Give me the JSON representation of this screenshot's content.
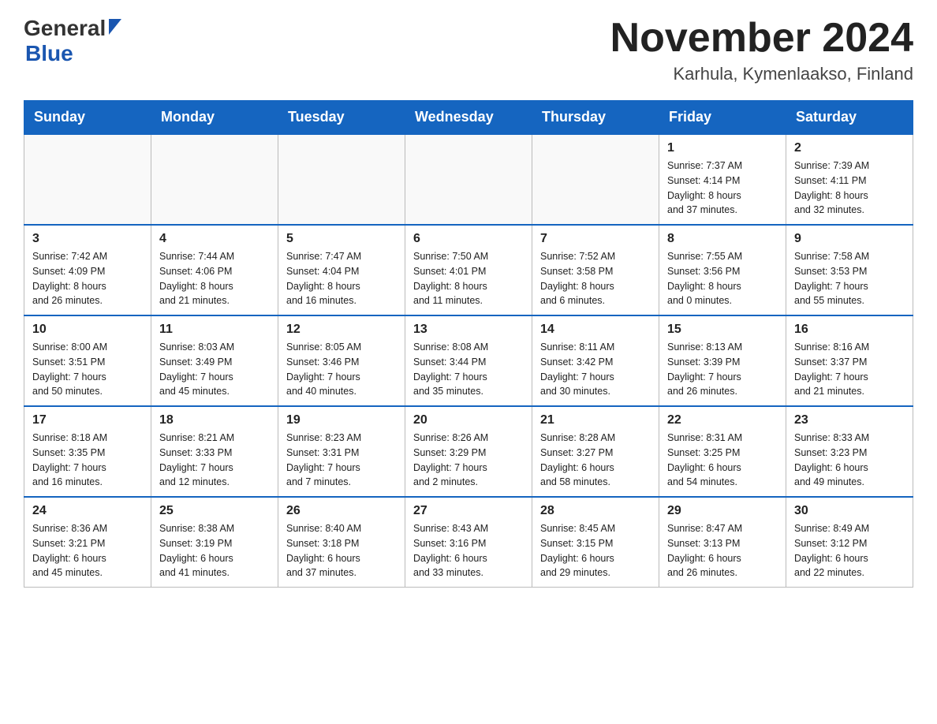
{
  "header": {
    "logo_general": "General",
    "logo_blue": "Blue",
    "month_title": "November 2024",
    "location": "Karhula, Kymenlaakso, Finland"
  },
  "days_of_week": [
    "Sunday",
    "Monday",
    "Tuesday",
    "Wednesday",
    "Thursday",
    "Friday",
    "Saturday"
  ],
  "weeks": [
    [
      {
        "day": "",
        "info": ""
      },
      {
        "day": "",
        "info": ""
      },
      {
        "day": "",
        "info": ""
      },
      {
        "day": "",
        "info": ""
      },
      {
        "day": "",
        "info": ""
      },
      {
        "day": "1",
        "info": "Sunrise: 7:37 AM\nSunset: 4:14 PM\nDaylight: 8 hours\nand 37 minutes."
      },
      {
        "day": "2",
        "info": "Sunrise: 7:39 AM\nSunset: 4:11 PM\nDaylight: 8 hours\nand 32 minutes."
      }
    ],
    [
      {
        "day": "3",
        "info": "Sunrise: 7:42 AM\nSunset: 4:09 PM\nDaylight: 8 hours\nand 26 minutes."
      },
      {
        "day": "4",
        "info": "Sunrise: 7:44 AM\nSunset: 4:06 PM\nDaylight: 8 hours\nand 21 minutes."
      },
      {
        "day": "5",
        "info": "Sunrise: 7:47 AM\nSunset: 4:04 PM\nDaylight: 8 hours\nand 16 minutes."
      },
      {
        "day": "6",
        "info": "Sunrise: 7:50 AM\nSunset: 4:01 PM\nDaylight: 8 hours\nand 11 minutes."
      },
      {
        "day": "7",
        "info": "Sunrise: 7:52 AM\nSunset: 3:58 PM\nDaylight: 8 hours\nand 6 minutes."
      },
      {
        "day": "8",
        "info": "Sunrise: 7:55 AM\nSunset: 3:56 PM\nDaylight: 8 hours\nand 0 minutes."
      },
      {
        "day": "9",
        "info": "Sunrise: 7:58 AM\nSunset: 3:53 PM\nDaylight: 7 hours\nand 55 minutes."
      }
    ],
    [
      {
        "day": "10",
        "info": "Sunrise: 8:00 AM\nSunset: 3:51 PM\nDaylight: 7 hours\nand 50 minutes."
      },
      {
        "day": "11",
        "info": "Sunrise: 8:03 AM\nSunset: 3:49 PM\nDaylight: 7 hours\nand 45 minutes."
      },
      {
        "day": "12",
        "info": "Sunrise: 8:05 AM\nSunset: 3:46 PM\nDaylight: 7 hours\nand 40 minutes."
      },
      {
        "day": "13",
        "info": "Sunrise: 8:08 AM\nSunset: 3:44 PM\nDaylight: 7 hours\nand 35 minutes."
      },
      {
        "day": "14",
        "info": "Sunrise: 8:11 AM\nSunset: 3:42 PM\nDaylight: 7 hours\nand 30 minutes."
      },
      {
        "day": "15",
        "info": "Sunrise: 8:13 AM\nSunset: 3:39 PM\nDaylight: 7 hours\nand 26 minutes."
      },
      {
        "day": "16",
        "info": "Sunrise: 8:16 AM\nSunset: 3:37 PM\nDaylight: 7 hours\nand 21 minutes."
      }
    ],
    [
      {
        "day": "17",
        "info": "Sunrise: 8:18 AM\nSunset: 3:35 PM\nDaylight: 7 hours\nand 16 minutes."
      },
      {
        "day": "18",
        "info": "Sunrise: 8:21 AM\nSunset: 3:33 PM\nDaylight: 7 hours\nand 12 minutes."
      },
      {
        "day": "19",
        "info": "Sunrise: 8:23 AM\nSunset: 3:31 PM\nDaylight: 7 hours\nand 7 minutes."
      },
      {
        "day": "20",
        "info": "Sunrise: 8:26 AM\nSunset: 3:29 PM\nDaylight: 7 hours\nand 2 minutes."
      },
      {
        "day": "21",
        "info": "Sunrise: 8:28 AM\nSunset: 3:27 PM\nDaylight: 6 hours\nand 58 minutes."
      },
      {
        "day": "22",
        "info": "Sunrise: 8:31 AM\nSunset: 3:25 PM\nDaylight: 6 hours\nand 54 minutes."
      },
      {
        "day": "23",
        "info": "Sunrise: 8:33 AM\nSunset: 3:23 PM\nDaylight: 6 hours\nand 49 minutes."
      }
    ],
    [
      {
        "day": "24",
        "info": "Sunrise: 8:36 AM\nSunset: 3:21 PM\nDaylight: 6 hours\nand 45 minutes."
      },
      {
        "day": "25",
        "info": "Sunrise: 8:38 AM\nSunset: 3:19 PM\nDaylight: 6 hours\nand 41 minutes."
      },
      {
        "day": "26",
        "info": "Sunrise: 8:40 AM\nSunset: 3:18 PM\nDaylight: 6 hours\nand 37 minutes."
      },
      {
        "day": "27",
        "info": "Sunrise: 8:43 AM\nSunset: 3:16 PM\nDaylight: 6 hours\nand 33 minutes."
      },
      {
        "day": "28",
        "info": "Sunrise: 8:45 AM\nSunset: 3:15 PM\nDaylight: 6 hours\nand 29 minutes."
      },
      {
        "day": "29",
        "info": "Sunrise: 8:47 AM\nSunset: 3:13 PM\nDaylight: 6 hours\nand 26 minutes."
      },
      {
        "day": "30",
        "info": "Sunrise: 8:49 AM\nSunset: 3:12 PM\nDaylight: 6 hours\nand 22 minutes."
      }
    ]
  ]
}
